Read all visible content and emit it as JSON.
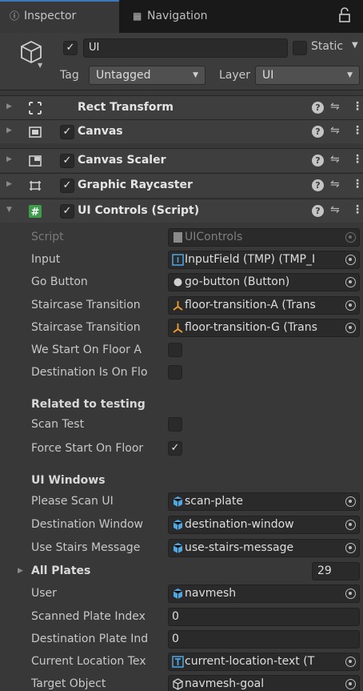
{
  "tabs": [
    {
      "label": "Inspector",
      "icon": "info-icon"
    },
    {
      "label": "Navigation",
      "icon": "navigation-icon"
    }
  ],
  "gameobject": {
    "active": true,
    "name": "UI",
    "static_label": "Static",
    "static": false,
    "tag_label": "Tag",
    "tag": "Untagged",
    "layer_label": "Layer",
    "layer": "UI"
  },
  "components": [
    {
      "name": "Rect Transform",
      "has_checkbox": false,
      "expanded": false
    },
    {
      "name": "Canvas",
      "has_checkbox": true,
      "enabled": true,
      "expanded": false
    },
    {
      "name": "Canvas Scaler",
      "has_checkbox": true,
      "enabled": true,
      "expanded": false
    },
    {
      "name": "Graphic Raycaster",
      "has_checkbox": true,
      "enabled": true,
      "expanded": false
    },
    {
      "name": "UI Controls (Script)",
      "has_checkbox": true,
      "enabled": true,
      "expanded": true
    }
  ],
  "fields": {
    "script": {
      "label": "Script",
      "value": "UIControls"
    },
    "input": {
      "label": "Input",
      "value": "InputField (TMP) (TMP_I"
    },
    "go_button": {
      "label": "Go Button",
      "value": "go-button (Button)"
    },
    "staircase_a": {
      "label": "Staircase Transition",
      "value": "floor-transition-A (Trans"
    },
    "staircase_g": {
      "label": "Staircase Transition",
      "value": "floor-transition-G (Trans"
    },
    "start_floor_a": {
      "label": "We Start On Floor A",
      "checked": false
    },
    "dest_on_floor": {
      "label": "Destination Is On Flo",
      "checked": false
    },
    "testing_header": "Related to testing",
    "scan_test": {
      "label": "Scan Test",
      "checked": false
    },
    "force_start": {
      "label": "Force Start On Floor",
      "checked": true
    },
    "windows_header": "UI Windows",
    "please_scan": {
      "label": "Please Scan UI",
      "value": "scan-plate"
    },
    "dest_window": {
      "label": "Destination Window",
      "value": "destination-window"
    },
    "use_stairs": {
      "label": "Use Stairs Message",
      "value": "use-stairs-message"
    },
    "all_plates": {
      "label": "All Plates",
      "count": "29"
    },
    "user": {
      "label": "User",
      "value": "navmesh"
    },
    "scanned_index": {
      "label": "Scanned Plate Index",
      "value": "0"
    },
    "dest_index": {
      "label": "Destination Plate Ind",
      "value": "0"
    },
    "current_loc": {
      "label": "Current Location Tex",
      "value": "current-location-text (T"
    },
    "target_object": {
      "label": "Target Object",
      "value": "navmesh-goal"
    }
  },
  "colors": {
    "background": "#383838",
    "tab_accent": "#3a79bb",
    "gameobject_icon": "#4fa7e3"
  }
}
